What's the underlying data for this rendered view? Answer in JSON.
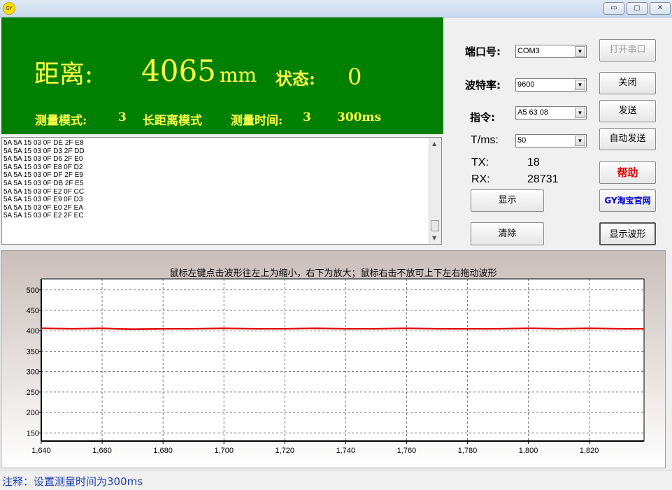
{
  "window": {
    "icon_text": "GY",
    "min": "▭",
    "max": "▢",
    "close": "✕"
  },
  "display": {
    "distance_label": "距离:",
    "distance_value": "4065",
    "distance_unit": "mm",
    "state_label": "状态:",
    "state_value": "0",
    "mode_label": "测量模式:",
    "mode_value": "3",
    "mode_name": "长距离模式",
    "time_label": "测量时间:",
    "time_value": "3",
    "time_ms": "300ms"
  },
  "log": [
    "5A 5A 15 03 0F DE 2F E8",
    "5A 5A 15 03 0F D3 2F DD",
    "5A 5A 15 03 0F D6 2F E0",
    "5A 5A 15 03 0F E8 0F D2",
    "5A 5A 15 03 0F DF 2F E9",
    "5A 5A 15 03 0F DB 2F E5",
    "5A 5A 15 03 0F E2 0F CC",
    "5A 5A 15 03 0F E9 0F D3",
    "5A 5A 15 03 0F E0 2F EA",
    "5A 5A 15 03 0F E2 2F EC"
  ],
  "controls": {
    "port_label": "端口号:",
    "port_value": "COM3",
    "baud_label": "波特率:",
    "baud_value": "9600",
    "cmd_label": "指令:",
    "cmd_value": "A5 63 08",
    "t_label": "T/ms:",
    "t_value": "50",
    "tx_label": "TX:",
    "tx_value": "18",
    "rx_label": "RX:",
    "rx_value": "28731",
    "show_btn": "显示",
    "clear_btn": "清除"
  },
  "buttons": {
    "open_port": "打开串口",
    "close": "关闭",
    "send": "发送",
    "auto_send": "自动发送",
    "help": "帮助",
    "taobao": "GY淘宝官网",
    "show_wave": "显示波形"
  },
  "chart_data": {
    "type": "line",
    "title": "鼠标左键点击波形往左上为缩小，右下为放大；鼠标右击不放可上下左右拖动波形",
    "xlabel": "",
    "ylabel": "",
    "xlim": [
      1640,
      1838
    ],
    "ylim": [
      130,
      527
    ],
    "x_ticks": [
      "1,640",
      "1,660",
      "1,680",
      "1,700",
      "1,720",
      "1,740",
      "1,760",
      "1,780",
      "1,800",
      "1,820"
    ],
    "y_ticks": [
      "500",
      "450",
      "400",
      "350",
      "300",
      "250",
      "200",
      "150"
    ],
    "grid": true,
    "line_color": "#e00000",
    "series": [
      {
        "x": [
          1640,
          1650,
          1660,
          1670,
          1680,
          1690,
          1700,
          1710,
          1720,
          1730,
          1740,
          1750,
          1760,
          1770,
          1780,
          1790,
          1800,
          1810,
          1820,
          1830,
          1838
        ],
        "values": [
          406,
          405,
          406,
          404,
          405,
          405,
          406,
          405,
          405,
          406,
          405,
          405,
          406,
          405,
          405,
          405,
          406,
          405,
          406,
          405,
          405
        ]
      }
    ]
  },
  "status": {
    "text": "注释：设置测量时间为300ms"
  }
}
